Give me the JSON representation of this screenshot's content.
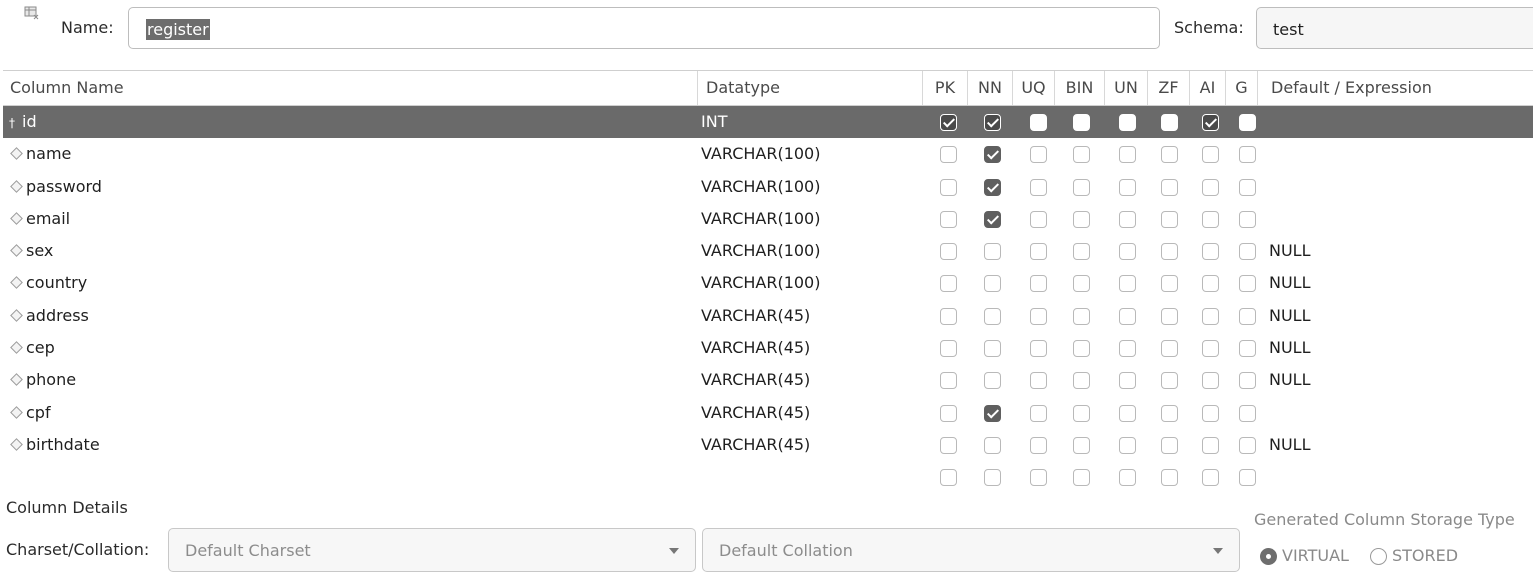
{
  "header": {
    "name_label": "Name:",
    "name_value": "register",
    "schema_label": "Schema:",
    "schema_value": "test",
    "table_icon": "table-icon"
  },
  "grid": {
    "headers": {
      "column_name": "Column Name",
      "datatype": "Datatype",
      "pk": "PK",
      "nn": "NN",
      "uq": "UQ",
      "bin": "BIN",
      "un": "UN",
      "zf": "ZF",
      "ai": "AI",
      "g": "G",
      "default": "Default / Expression"
    },
    "rows": [
      {
        "name": "id",
        "type": "INT",
        "flags": [
          1,
          1,
          0,
          0,
          0,
          0,
          1,
          0
        ],
        "default": "",
        "selected": true
      },
      {
        "name": "name",
        "type": "VARCHAR(100)",
        "flags": [
          0,
          1,
          0,
          0,
          0,
          0,
          0,
          0
        ],
        "default": ""
      },
      {
        "name": "password",
        "type": "VARCHAR(100)",
        "flags": [
          0,
          1,
          0,
          0,
          0,
          0,
          0,
          0
        ],
        "default": ""
      },
      {
        "name": "email",
        "type": "VARCHAR(100)",
        "flags": [
          0,
          1,
          0,
          0,
          0,
          0,
          0,
          0
        ],
        "default": ""
      },
      {
        "name": "sex",
        "type": "VARCHAR(100)",
        "flags": [
          0,
          0,
          0,
          0,
          0,
          0,
          0,
          0
        ],
        "default": "NULL"
      },
      {
        "name": "country",
        "type": "VARCHAR(100)",
        "flags": [
          0,
          0,
          0,
          0,
          0,
          0,
          0,
          0
        ],
        "default": "NULL"
      },
      {
        "name": "address",
        "type": "VARCHAR(45)",
        "flags": [
          0,
          0,
          0,
          0,
          0,
          0,
          0,
          0
        ],
        "default": "NULL"
      },
      {
        "name": "cep",
        "type": "VARCHAR(45)",
        "flags": [
          0,
          0,
          0,
          0,
          0,
          0,
          0,
          0
        ],
        "default": "NULL"
      },
      {
        "name": "phone",
        "type": "VARCHAR(45)",
        "flags": [
          0,
          0,
          0,
          0,
          0,
          0,
          0,
          0
        ],
        "default": "NULL"
      },
      {
        "name": "cpf",
        "type": "VARCHAR(45)",
        "flags": [
          0,
          1,
          0,
          0,
          0,
          0,
          0,
          0
        ],
        "default": ""
      },
      {
        "name": "birthdate",
        "type": "VARCHAR(45)",
        "flags": [
          0,
          0,
          0,
          0,
          0,
          0,
          0,
          0
        ],
        "default": "NULL"
      },
      {
        "name": "",
        "type": "",
        "flags": [
          0,
          0,
          0,
          0,
          0,
          0,
          0,
          0
        ],
        "default": "",
        "placeholder": true
      }
    ]
  },
  "details": {
    "section_label": "Column Details",
    "charset_label": "Charset/Collation:",
    "charset_value": "Default Charset",
    "collation_value": "Default Collation",
    "storage_label": "Generated Column Storage Type",
    "virtual_label": "VIRTUAL",
    "stored_label": "STORED",
    "storage_selected": "VIRTUAL"
  }
}
